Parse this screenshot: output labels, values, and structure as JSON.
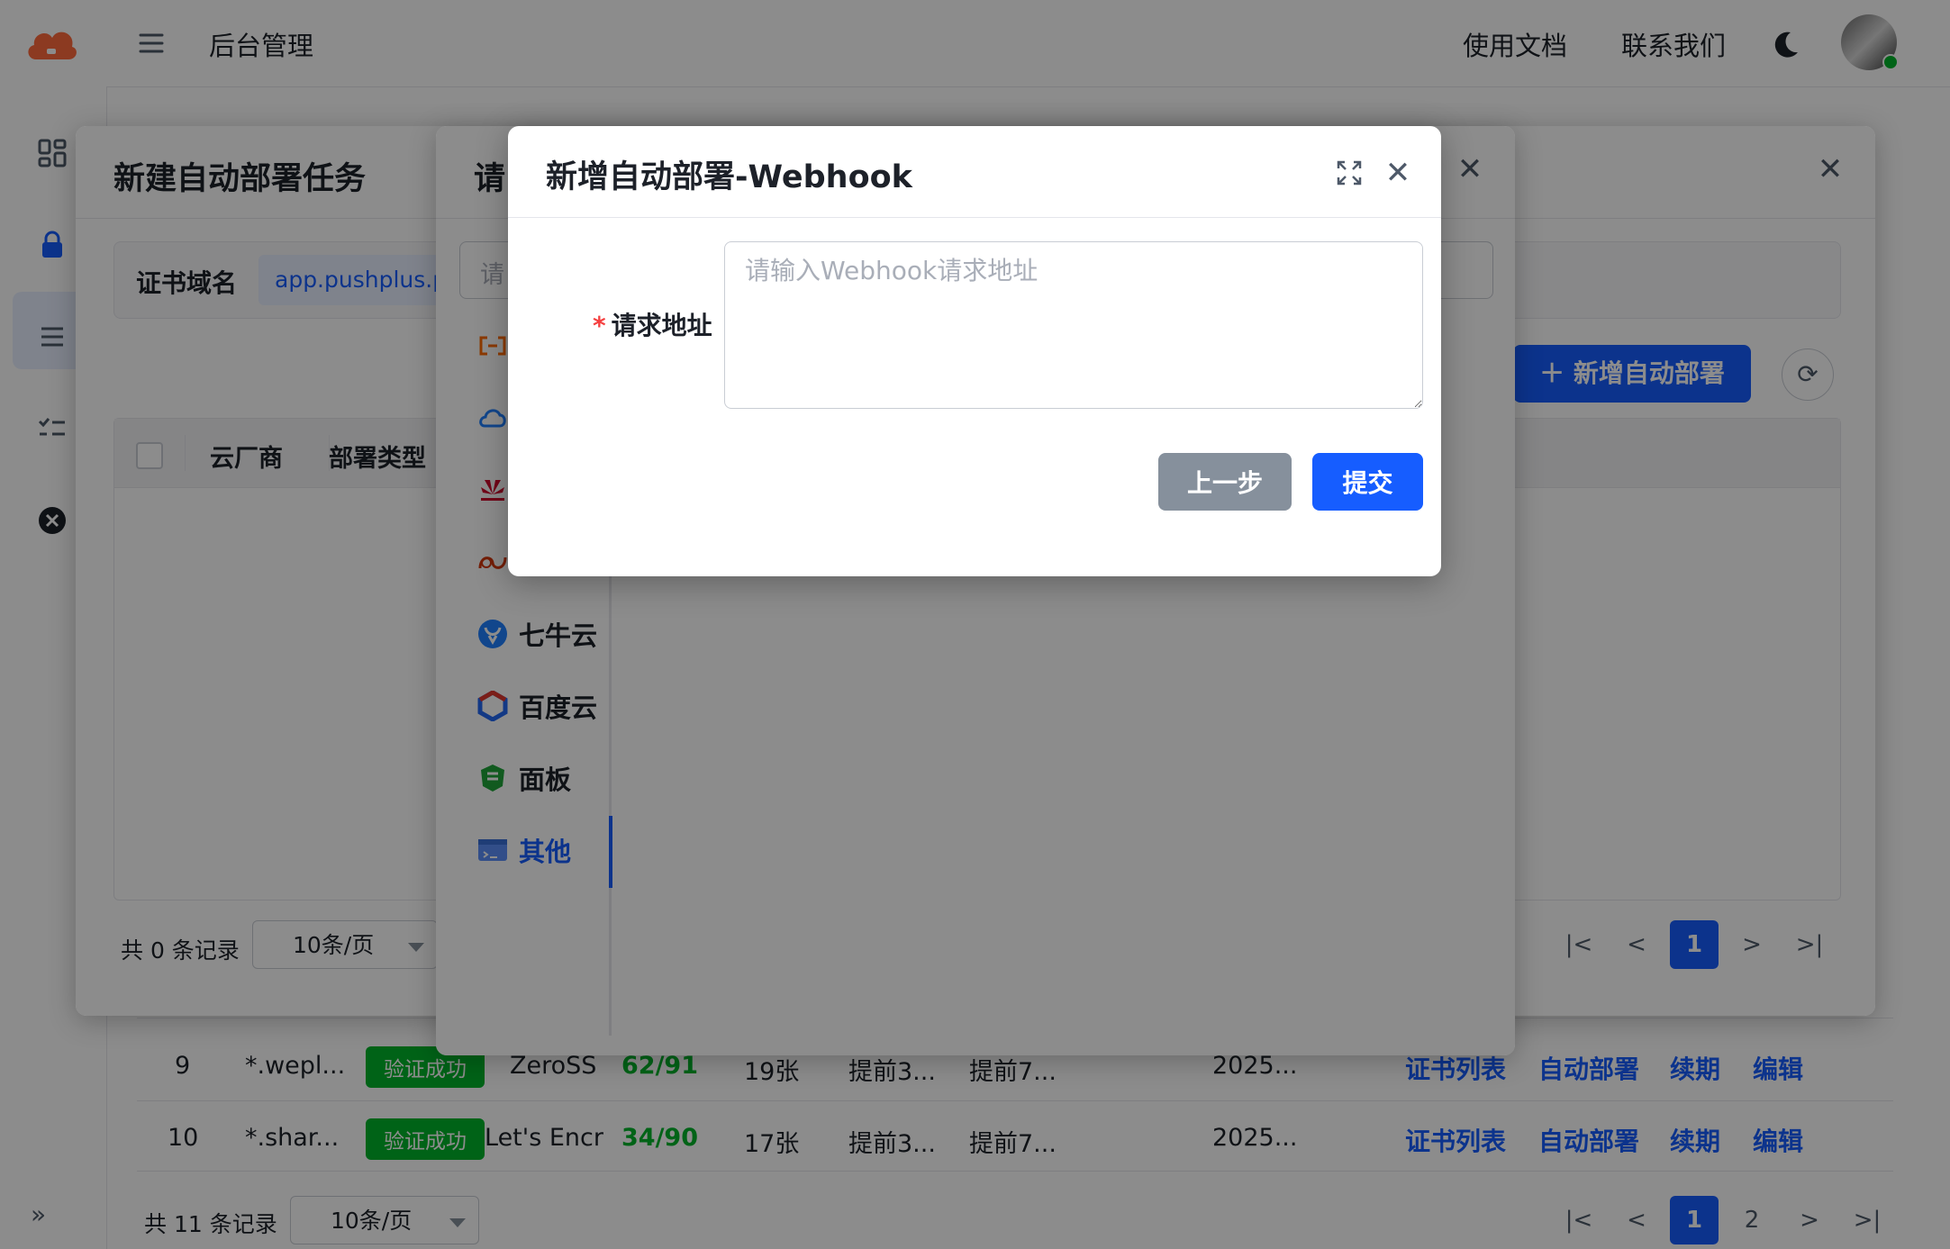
{
  "header": {
    "title": "后台管理",
    "docs_link": "使用文档",
    "contact_link": "联系我们",
    "menu_icon": "hamburger-icon",
    "theme_icon": "moon-icon"
  },
  "sidebar": {
    "icons": [
      "dashboard-icon",
      "lock-icon",
      "list-icon",
      "checklist-icon",
      "close-circle-icon"
    ],
    "collapse_icon": "double-chevron-right-icon"
  },
  "background_table": {
    "rows": [
      {
        "index": "9",
        "domain": "*.wepl...",
        "status": "验证成功",
        "issuer": "ZeroSS",
        "days": "62/91",
        "certs": "19张",
        "renew": "提前3...",
        "notify": "提前7...",
        "expires": "2025...",
        "actions": [
          "证书列表",
          "自动部署",
          "续期",
          "编辑"
        ]
      },
      {
        "index": "10",
        "domain": "*.shar...",
        "status": "验证成功",
        "issuer": "Let's Encr",
        "days": "34/90",
        "certs": "17张",
        "renew": "提前3...",
        "notify": "提前7...",
        "expires": "2025...",
        "actions": [
          "证书列表",
          "自动部署",
          "续期",
          "编辑"
        ]
      }
    ],
    "total_text": "共 11 条记录",
    "page_size": "10条/页",
    "pages": [
      "1",
      "2"
    ],
    "current_page": "1"
  },
  "deploy_task_modal": {
    "title": "新建自动部署任务",
    "domain_label": "证书域名",
    "domain_value": "app.pushplus.p",
    "columns": [
      "云厂商",
      "部署类型"
    ],
    "add_button": "新增自动部署",
    "total_text": "共 0 条记录",
    "page_size": "10条/页",
    "current_page": "1"
  },
  "provider_modal": {
    "title_partial": "请",
    "search_placeholder_partial": "请",
    "providers": [
      {
        "name": "",
        "icon": "aliyun-icon",
        "color": "#ff6a00"
      },
      {
        "name": "",
        "icon": "tencent-cloud-icon",
        "color": "#0052d9"
      },
      {
        "name": "",
        "icon": "huawei-icon",
        "color": "#cf0a2c"
      },
      {
        "name": "",
        "icon": "volcengine-icon",
        "color": "#d4380d"
      },
      {
        "name": "七牛云",
        "icon": "qiniu-icon",
        "color": "#1f80ff"
      },
      {
        "name": "百度云",
        "icon": "baidu-cloud-icon",
        "color": "#2468f2"
      },
      {
        "name": "面板",
        "icon": "panel-icon",
        "color": "#20a53a"
      },
      {
        "name": "其他",
        "icon": "other-icon",
        "color": "#5b8ff9"
      }
    ],
    "active_provider": "其他"
  },
  "webhook_modal": {
    "title": "新增自动部署-Webhook",
    "field_label": "请求地址",
    "required_mark": "*",
    "placeholder": "请输入Webhook请求地址",
    "value": "",
    "prev_button": "上一步",
    "submit_button": "提交",
    "fullscreen_icon": "fullscreen-icon",
    "close_icon": "close-icon"
  },
  "colors": {
    "primary": "#165dff",
    "success": "#00b42a",
    "danger": "#f53f3f",
    "secondary_button": "#86909c"
  }
}
